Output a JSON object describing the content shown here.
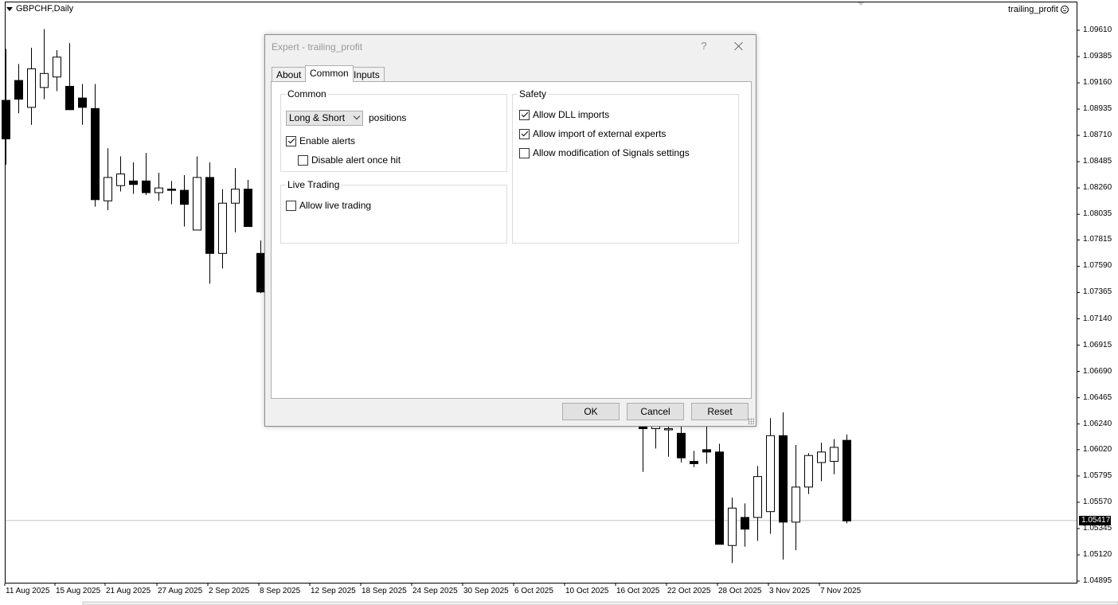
{
  "chart": {
    "symbol": "GBPCHF,Daily",
    "ea_name": "trailing_profit",
    "current_price": "1.05417",
    "price_labels": [
      "1.09610",
      "1.09385",
      "1.09160",
      "1.08935",
      "1.08710",
      "1.08485",
      "1.08260",
      "1.08035",
      "1.07815",
      "1.07590",
      "1.07365",
      "1.07140",
      "1.06915",
      "1.06690",
      "1.06465",
      "1.06240",
      "1.06020",
      "1.05795",
      "1.05570",
      "1.05345",
      "1.05120",
      "1.04895"
    ],
    "date_labels": [
      "11 Aug 2025",
      "15 Aug 2025",
      "21 Aug 2025",
      "27 Aug 2025",
      "2 Sep 2025",
      "8 Sep 2025",
      "12 Sep 2025",
      "18 Sep 2025",
      "24 Sep 2025",
      "30 Sep 2025",
      "6 Oct 2025",
      "10 Oct 2025",
      "16 Oct 2025",
      "22 Oct 2025",
      "28 Oct 2025",
      "3 Nov 2025",
      "7 Nov 2025"
    ],
    "candles": [
      {
        "o": 1.0901,
        "h": 1.0945,
        "l": 1.0846,
        "c": 1.0868
      },
      {
        "o": 1.0918,
        "h": 1.0932,
        "l": 1.089,
        "c": 1.0902
      },
      {
        "o": 1.0895,
        "h": 1.0946,
        "l": 1.088,
        "c": 1.0928
      },
      {
        "o": 1.0912,
        "h": 1.0962,
        "l": 1.0902,
        "c": 1.0924
      },
      {
        "o": 1.0921,
        "h": 1.0944,
        "l": 1.0909,
        "c": 1.0938
      },
      {
        "o": 1.0913,
        "h": 1.095,
        "l": 1.0898,
        "c": 1.0893
      },
      {
        "o": 1.0903,
        "h": 1.0915,
        "l": 1.088,
        "c": 1.0895
      },
      {
        "o": 1.0894,
        "h": 1.0915,
        "l": 1.081,
        "c": 1.0816
      },
      {
        "o": 1.0815,
        "h": 1.086,
        "l": 1.0807,
        "c": 1.0835
      },
      {
        "o": 1.0828,
        "h": 1.0853,
        "l": 1.0823,
        "c": 1.0838
      },
      {
        "o": 1.0832,
        "h": 1.0848,
        "l": 1.0821,
        "c": 1.0829
      },
      {
        "o": 1.0832,
        "h": 1.0856,
        "l": 1.082,
        "c": 1.0822
      },
      {
        "o": 1.0822,
        "h": 1.0839,
        "l": 1.0815,
        "c": 1.0826
      },
      {
        "o": 1.0825,
        "h": 1.0832,
        "l": 1.0812,
        "c": 1.0824
      },
      {
        "o": 1.0824,
        "h": 1.0837,
        "l": 1.0793,
        "c": 1.0812
      },
      {
        "o": 1.079,
        "h": 1.0853,
        "l": 1.079,
        "c": 1.0835
      },
      {
        "o": 1.0835,
        "h": 1.0848,
        "l": 1.0744,
        "c": 1.077
      },
      {
        "o": 1.077,
        "h": 1.0825,
        "l": 1.0757,
        "c": 1.0813
      },
      {
        "o": 1.0813,
        "h": 1.0843,
        "l": 1.0788,
        "c": 1.0825
      },
      {
        "o": 1.0825,
        "h": 1.0833,
        "l": 1.0793,
        "c": 1.0793
      },
      {
        "o": 1.077,
        "h": 1.0781,
        "l": 1.0736,
        "c": 1.0737
      },
      {
        "o": 1.0627,
        "h": 1.0637,
        "l": 1.0583,
        "c": 1.062
      },
      {
        "o": 1.062,
        "h": 1.0634,
        "l": 1.0603,
        "c": 1.0628
      },
      {
        "o": 1.0619,
        "h": 1.0636,
        "l": 1.0596,
        "c": 1.062
      },
      {
        "o": 1.0616,
        "h": 1.0622,
        "l": 1.0591,
        "c": 1.0595
      },
      {
        "o": 1.0592,
        "h": 1.0601,
        "l": 1.0587,
        "c": 1.059
      },
      {
        "o": 1.0602,
        "h": 1.0622,
        "l": 1.059,
        "c": 1.06
      },
      {
        "o": 1.06,
        "h": 1.0607,
        "l": 1.0521,
        "c": 1.0521
      },
      {
        "o": 1.052,
        "h": 1.0561,
        "l": 1.0505,
        "c": 1.0552
      },
      {
        "o": 1.0544,
        "h": 1.0556,
        "l": 1.0519,
        "c": 1.0534
      },
      {
        "o": 1.0544,
        "h": 1.0588,
        "l": 1.0524,
        "c": 1.0579
      },
      {
        "o": 1.0549,
        "h": 1.0629,
        "l": 1.053,
        "c": 1.0614
      },
      {
        "o": 1.0614,
        "h": 1.0634,
        "l": 1.0508,
        "c": 1.054
      },
      {
        "o": 1.054,
        "h": 1.0606,
        "l": 1.0516,
        "c": 1.057
      },
      {
        "o": 1.057,
        "h": 1.0599,
        "l": 1.0564,
        "c": 1.0597
      },
      {
        "o": 1.0591,
        "h": 1.0608,
        "l": 1.0575,
        "c": 1.06
      },
      {
        "o": 1.0592,
        "h": 1.0611,
        "l": 1.0581,
        "c": 1.0604
      },
      {
        "o": 1.061,
        "h": 1.0615,
        "l": 1.0539,
        "c": 1.0541
      }
    ]
  },
  "dialog": {
    "title": "Expert - trailing_profit",
    "help": "?",
    "tabs": [
      "About",
      "Common",
      "Inputs"
    ],
    "common": {
      "label": "Common",
      "positions_value": "Long & Short",
      "positions_label": "positions",
      "enable_alerts": "Enable alerts",
      "disable_alert_once_hit": "Disable alert once hit"
    },
    "live_trading": {
      "label": "Live Trading",
      "allow_live_trading": "Allow live trading"
    },
    "safety": {
      "label": "Safety",
      "allow_dll_imports": "Allow DLL imports",
      "allow_import_external": "Allow import of external experts",
      "allow_modification_signals": "Allow modification of Signals settings"
    },
    "buttons": {
      "ok": "OK",
      "cancel": "Cancel",
      "reset": "Reset"
    }
  }
}
